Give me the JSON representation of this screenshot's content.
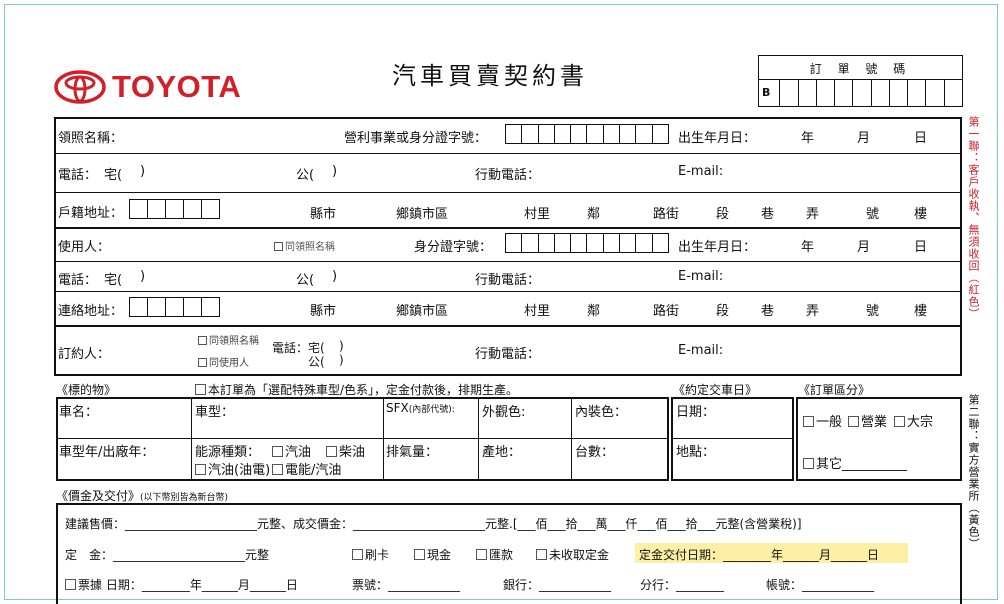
{
  "header": {
    "brand": "TOYOTA",
    "title": "汽車買賣契約書",
    "order_number_label": "訂 單 號 碼",
    "order_prefix": "B"
  },
  "side_notes": {
    "copy1": "第一聯：客戶收執、無須收回（紅色）",
    "copy2": "第二聯：實方營業所（黃色）"
  },
  "owner": {
    "license_name": "領照名稱：",
    "id_label": "營利事業或身分證字號：",
    "birth_label": "出生年月日：",
    "year": "年",
    "month": "月",
    "day": "日",
    "phone": "電話：",
    "home": "宅(",
    "home_close": ")",
    "office": "公(",
    "office_close": ")",
    "mobile": "行動電話：",
    "email": "E-mail:",
    "address_label": "戶籍地址："
  },
  "address_parts": [
    "縣市",
    "鄉鎮市區",
    "村里",
    "鄰",
    "路街",
    "段",
    "巷",
    "弄",
    "號",
    "樓"
  ],
  "user": {
    "label": "使用人：",
    "same_as": "同領照名稱",
    "id_label": "身分證字號：",
    "birth_label": "出生年月日：",
    "phone": "電話：",
    "home": "宅(",
    "home_close": ")",
    "office": "公(",
    "office_close": ")",
    "mobile": "行動電話：",
    "email": "E-mail:",
    "address_label": "連絡地址："
  },
  "orderer": {
    "label": "訂約人：",
    "same_license": "同領照名稱",
    "same_user": "同使用人",
    "phone": "電話：宅(",
    "phone_close": ")",
    "office": "公(",
    "office_close": ")",
    "mobile": "行動電話：",
    "email": "E-mail:"
  },
  "subject": {
    "heading": "《標的物》",
    "special_note": "本訂單為「選配特殊車型/色系」，定金付款後，排期生產。",
    "delivery_heading": "《約定交車日》",
    "category_heading": "《訂單區分》",
    "car_name": "車名：",
    "car_type": "車型：",
    "sfx": "SFX",
    "sfx_note": "(內部代號):",
    "exterior": "外觀色:",
    "interior": "內裝色：",
    "date": "日期：",
    "model_year": "車型年/出廠年：",
    "energy": "能源種類：",
    "gasoline": "汽油",
    "diesel": "柴油",
    "hybrid": "汽油(油電)",
    "electric": "電能/汽油",
    "displacement": "排氣量：",
    "origin": "產地：",
    "quantity": "台數：",
    "place": "地點：",
    "general": "一般",
    "business": "營業",
    "bulk": "大宗",
    "other": "其它__________"
  },
  "payment": {
    "heading": "《價金及交付》",
    "currency_note": "(以下幣別皆為新台幣)",
    "line1": "建議售價：______________________元整、成交價金：______________________元整.[___佰___拾___萬___仟___佰___拾___元整(含營業稅)]",
    "deposit_label": "定　金：______________________元整",
    "card": "刷卡",
    "cash": "現金",
    "transfer": "匯款",
    "no_deposit": "未收取定金",
    "deposit_date": "定金交付日期：________年______月______日",
    "line3_check": "票據 日期：________年______月______日",
    "ticket_no": "票號：____________",
    "bank": "銀行：____________",
    "branch": "分行：________",
    "account": "帳號：____________"
  },
  "colors": {
    "brand_red": "#d0202a",
    "highlight": "#fdf0a4"
  }
}
